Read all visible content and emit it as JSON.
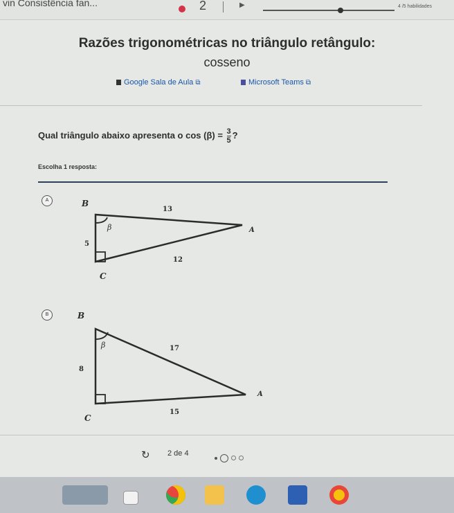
{
  "topbar": {
    "title": "vin Consistência fan...",
    "current_number": "2",
    "skills": "4 /5 habilidades"
  },
  "header": {
    "title": "Razões trigonométricas no triângulo retângulo:",
    "subtitle": "cosseno"
  },
  "links": {
    "google": "Google Sala de Aula",
    "teams": "Microsoft Teams"
  },
  "question": {
    "prefix": "Qual triângulo abaixo apresenta o cos (β) =",
    "numerator": "3",
    "denominator": "5",
    "suffix": "?"
  },
  "instruction": "Escolha 1 resposta:",
  "options": [
    {
      "letter": "A",
      "labels": {
        "B": "B",
        "A": "A",
        "C": "C",
        "beta": "β",
        "hyp": "13",
        "vert": "5",
        "base": "12"
      }
    },
    {
      "letter": "B",
      "labels": {
        "B": "B",
        "A": "A",
        "C": "C",
        "beta": "β",
        "hyp": "17",
        "vert": "8",
        "base": "15"
      }
    }
  ],
  "pager": {
    "text": "2 de 4",
    "total_steps": 4,
    "current_step": 2
  },
  "colors": {
    "accent": "#1a56a6",
    "red_dot": "#d2344a",
    "rule": "#2f3f55"
  },
  "taskbar_icons": [
    "wallpaper-thumb",
    "file-icon",
    "chrome-icon",
    "folder-icon",
    "edge-icon",
    "store-icon",
    "chrome-icon-alt"
  ]
}
